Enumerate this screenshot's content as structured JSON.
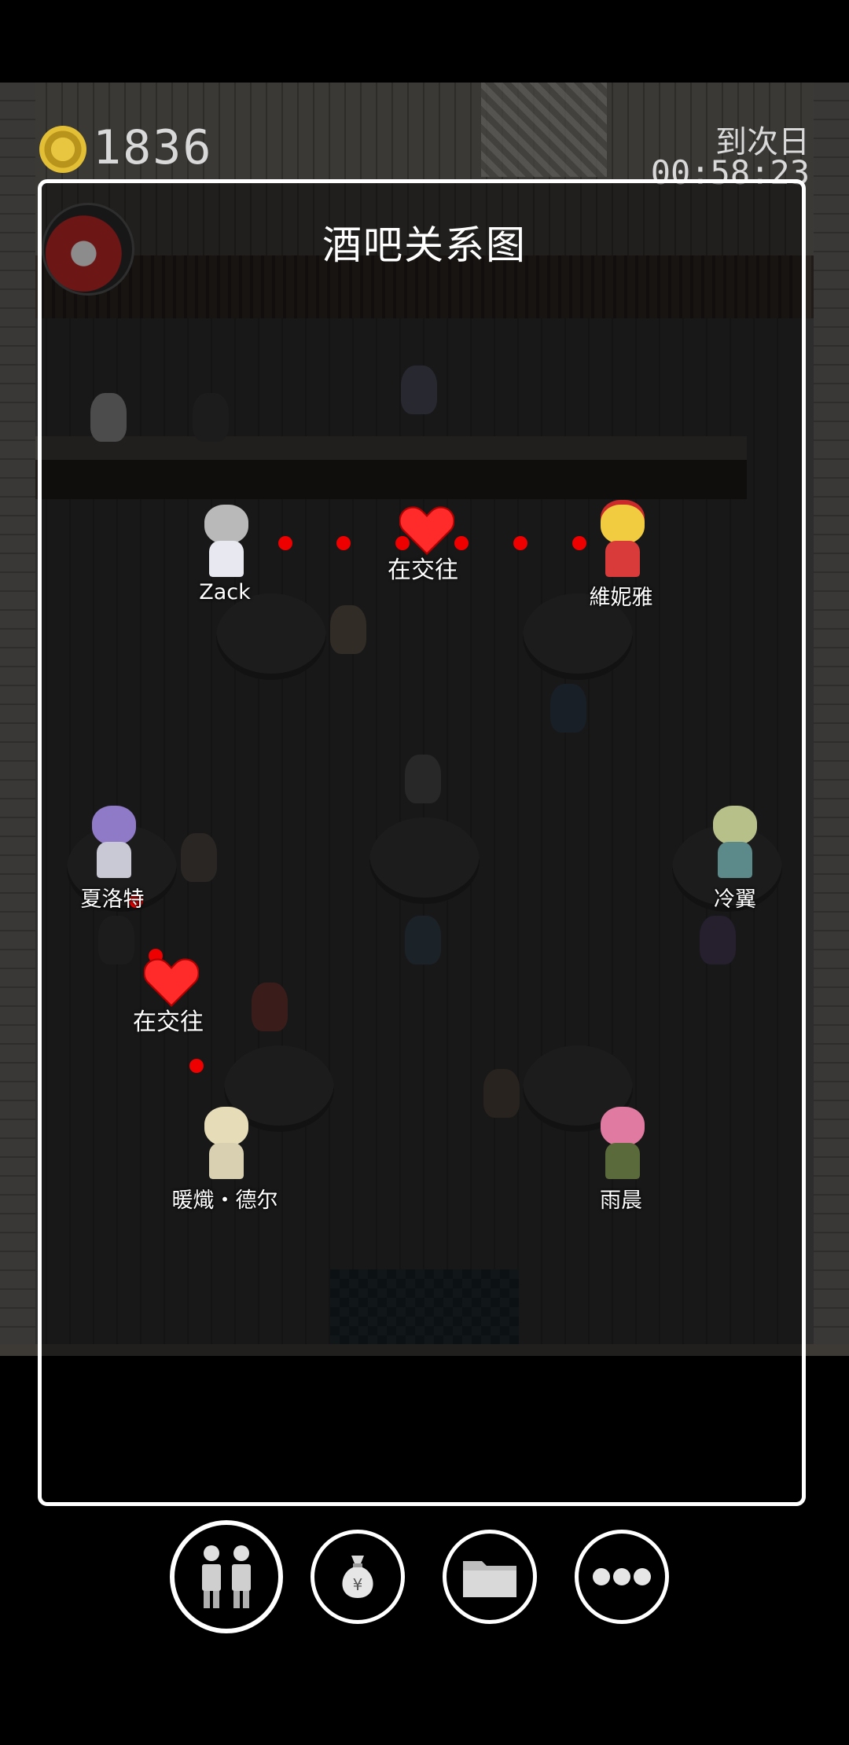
{
  "hud": {
    "money": "1836",
    "next_day_label": "到次日",
    "timer": "00:58:23"
  },
  "panel": {
    "title": "酒吧关系图"
  },
  "characters": {
    "zack": "Zack",
    "vivia": "維妮雅",
    "charlotte": "夏洛特",
    "lengyi": "冷翼",
    "nuancang": "暖熾・德尔",
    "yuchen": "雨晨"
  },
  "relations": [
    {
      "label": "在交往"
    },
    {
      "label": "在交往"
    }
  ],
  "toolbar": {
    "buttons": [
      {
        "icon": "people-icon"
      },
      {
        "icon": "money-bag-icon"
      },
      {
        "icon": "folder-icon"
      },
      {
        "icon": "more-icon"
      }
    ]
  },
  "colors": {
    "relation_line": "#e00000",
    "heart": "#ff2a2a",
    "panel_border": "#ffffff"
  }
}
